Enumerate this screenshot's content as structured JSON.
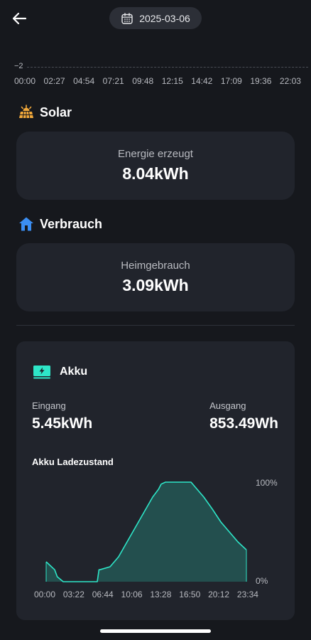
{
  "header": {
    "date": "2025-03-06"
  },
  "top_chart": {
    "axis_value": "−2",
    "times": [
      "00:00",
      "02:27",
      "04:54",
      "07:21",
      "09:48",
      "12:15",
      "14:42",
      "17:09",
      "19:36",
      "22:03"
    ]
  },
  "solar": {
    "title": "Solar",
    "label": "Energie erzeugt",
    "value": "8.04kWh"
  },
  "verbrauch": {
    "title": "Verbrauch",
    "label": "Heimgebrauch",
    "value": "3.09kWh"
  },
  "akku": {
    "title": "Akku",
    "input_label": "Eingang",
    "input_value": "5.45kWh",
    "output_label": "Ausgang",
    "output_value": "853.49Wh",
    "chart_title": "Akku Ladezustand",
    "y_max_label": "100%",
    "y_min_label": "0%",
    "x_ticks": [
      "00:00",
      "03:22",
      "06:44",
      "10:06",
      "13:28",
      "16:50",
      "20:12",
      "23:34"
    ]
  },
  "colors": {
    "accent": "#2ee6c8",
    "solar_icon": "#f2a93b",
    "home_icon": "#3b8ef2",
    "background": "#16181d",
    "card": "#21242c"
  },
  "chart_data": {
    "type": "area",
    "title": "Akku Ladezustand",
    "x_unit": "hours",
    "ylim": [
      0,
      100
    ],
    "x": [
      0.0,
      1.0,
      1.3,
      2.0,
      4.0,
      6.0,
      6.2,
      6.3,
      7.5,
      8.5,
      9.5,
      10.5,
      11.5,
      12.5,
      13.2,
      13.5,
      14.0,
      16.0,
      17.0,
      17.5,
      18.5,
      19.5,
      20.5,
      21.5,
      22.5,
      23.5
    ],
    "values": [
      20,
      12,
      5,
      0,
      0,
      0,
      12,
      12,
      15,
      25,
      40,
      55,
      70,
      85,
      93,
      98,
      100,
      100,
      100,
      95,
      85,
      73,
      60,
      50,
      40,
      32
    ]
  }
}
